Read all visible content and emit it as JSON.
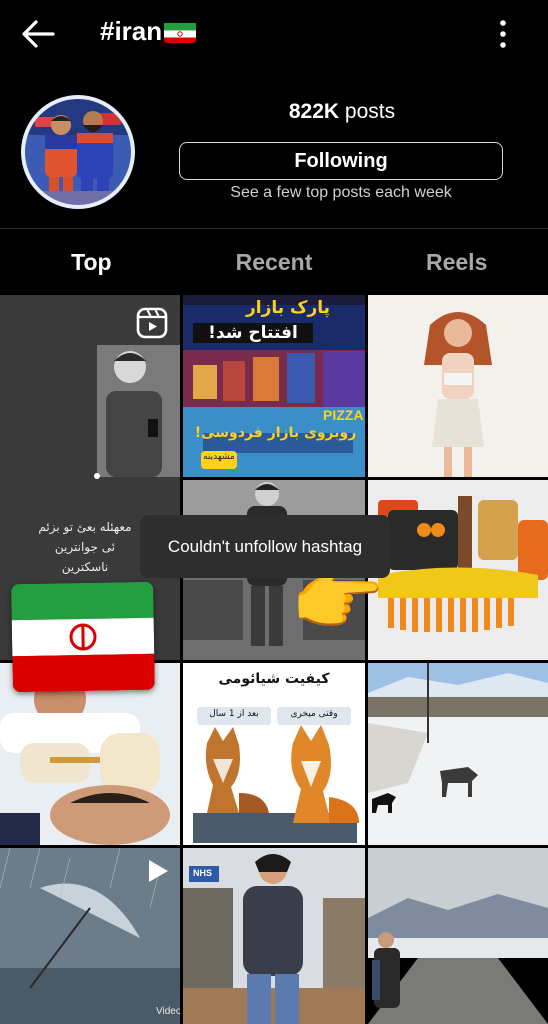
{
  "header": {
    "back_icon": "arrow-left-icon",
    "title": "#iran",
    "title_flag": "iran-flag-emoji",
    "menu_icon": "more-vertical-icon"
  },
  "profile": {
    "posts_count": "822K",
    "posts_label": "posts",
    "follow_button": "Following",
    "subtext": "See a few top posts each week"
  },
  "tabs": [
    {
      "label": "Top",
      "active": true
    },
    {
      "label": "Recent",
      "active": false
    },
    {
      "label": "Reels",
      "active": false
    }
  ],
  "grid": {
    "tile1_lines": [
      "معهئله بعئ تو بزئم",
      "ئی جوانترین",
      "ناسکترین"
    ],
    "tile2_title_1": "پارک بازار",
    "tile2_title_2": "افتتاح شد!",
    "tile2_bottom": "روبروی بازار فردوسی!",
    "tile2_tag": "مشهدینه",
    "tile2_sign": "PIZZA",
    "tile8_title": "کیفیت شیائومی",
    "tile8_left": "بعد از 1 سال",
    "tile8_right": "وقتی میخری",
    "tile10_video": "Video",
    "tile11_sign": "NHS"
  },
  "toast": {
    "text": "Couldn't unfollow hashtag"
  },
  "overlay": {
    "hand_emoji": "👉",
    "flag": "iran-flag-sticker"
  },
  "colors": {
    "background": "#000000",
    "flag_green": "#239f40",
    "flag_red": "#da0000",
    "toast_bg": "#2e2e2e"
  }
}
